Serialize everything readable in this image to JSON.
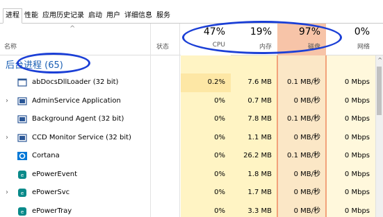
{
  "tabs": [
    "进程",
    "性能",
    "应用历史记录",
    "启动",
    "用户",
    "详细信息",
    "服务"
  ],
  "header": {
    "name_label": "名称",
    "status_label": "状态",
    "cpu": {
      "pct": "47%",
      "label": "CPU"
    },
    "memory": {
      "pct": "19%",
      "label": "内存"
    },
    "disk": {
      "pct": "97%",
      "label": "磁盘"
    },
    "network": {
      "pct": "0%",
      "label": "网络"
    }
  },
  "group_label": "后台进程 (65)",
  "processes": [
    {
      "name": "abDocsDllLoader (32 bit)",
      "expandable": false,
      "icon": "window-icon",
      "cpu": "0.2%",
      "mem": "7.6 MB",
      "disk": "0.1 MB/秒",
      "net": "0 Mbps"
    },
    {
      "name": "AdminService Application",
      "expandable": true,
      "icon": "app-icon",
      "cpu": "0%",
      "mem": "0.7 MB",
      "disk": "0 MB/秒",
      "net": "0 Mbps"
    },
    {
      "name": "Background Agent (32 bit)",
      "expandable": false,
      "icon": "app-icon",
      "cpu": "0%",
      "mem": "7.8 MB",
      "disk": "0.1 MB/秒",
      "net": "0 Mbps"
    },
    {
      "name": "CCD Monitor Service (32 bit)",
      "expandable": true,
      "icon": "app-icon",
      "cpu": "0%",
      "mem": "1.1 MB",
      "disk": "0 MB/秒",
      "net": "0 Mbps"
    },
    {
      "name": "Cortana",
      "expandable": false,
      "icon": "cortana-icon",
      "cpu": "0%",
      "mem": "26.2 MB",
      "disk": "0.1 MB/秒",
      "net": "0 Mbps"
    },
    {
      "name": "ePowerEvent",
      "expandable": false,
      "icon": "epower-icon",
      "cpu": "0%",
      "mem": "1.8 MB",
      "disk": "0 MB/秒",
      "net": "0 Mbps"
    },
    {
      "name": "ePowerSvc",
      "expandable": true,
      "icon": "epower-icon",
      "cpu": "0%",
      "mem": "1.7 MB",
      "disk": "0 MB/秒",
      "net": "0 Mbps"
    },
    {
      "name": "ePowerTray",
      "expandable": false,
      "icon": "epower-icon",
      "cpu": "0%",
      "mem": "3.3 MB",
      "disk": "0 MB/秒",
      "net": "0 Mbps"
    }
  ],
  "colors": {
    "annotation": "#1b3fd6",
    "group_text": "#1a5fb4",
    "disk_header": "#f7c4a8"
  }
}
